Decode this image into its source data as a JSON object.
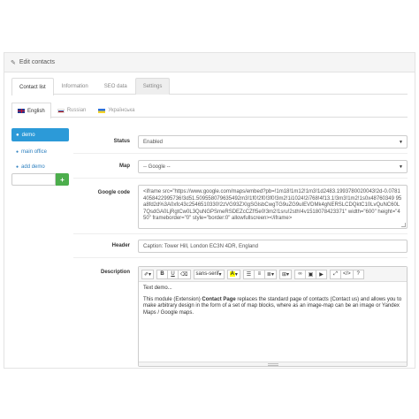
{
  "panel": {
    "title": "Edit contacts"
  },
  "tabs": [
    {
      "label": "Contact list"
    },
    {
      "label": "Information"
    },
    {
      "label": "SEO data"
    },
    {
      "label": "Settings"
    }
  ],
  "languages": [
    {
      "label": "English"
    },
    {
      "label": "Russian"
    },
    {
      "label": "Українська"
    }
  ],
  "sidebar": {
    "active": "demo",
    "items": [
      {
        "label": "main office"
      }
    ],
    "add_label": "add demo",
    "add_button": "+"
  },
  "form": {
    "status": {
      "label": "Status",
      "value": "Enabled"
    },
    "map": {
      "label": "Map",
      "value": "-- Google --"
    },
    "google_code": {
      "label": "Google code",
      "value": "<iframe src=\"https://www.google.com/maps/embed?pb=!1m18!1m12!1m3!1d2483.1993780020043!2d-0.07814058422995736!3d51.509558079635492m3!1f0!2f0!3f0!3m2!1i1024!2i768!4f13.1!3m3!1m2!1s0x48760349 95a8fd2d%3A0xfc43c2546510330!2zVG93ZXIgSGlsbCwgTG9uZG9uIEVDMk4gNERSLCDQktC10LvQuNC60L7QsdGA0LjRgtCw0L3QuNGPSmeRSDEZcCZf!5e0!3m2!1sru!2sth!4v1518078423371\" width=\"600\" height=\"450\" frameborder=\"0\" style=\"border:0\" allowfullscreen></iframe>"
    },
    "header": {
      "label": "Header",
      "value": "Caption: Tower Hill, London EC3N 4DR, England"
    },
    "description": {
      "label": "Description",
      "toolbar": {
        "font": "sans-serif",
        "highlight": "A"
      },
      "line1": "Text demo...",
      "line2_before": "This module (Extension) ",
      "line2_bold": "Contact Page",
      "line2_after": " replaces the standard page of contacts (Contact us) and allows you to make arbitrary design in the form of a set of map blocks, where as an image-map can be an image or Yandex Maps / Google maps."
    }
  }
}
